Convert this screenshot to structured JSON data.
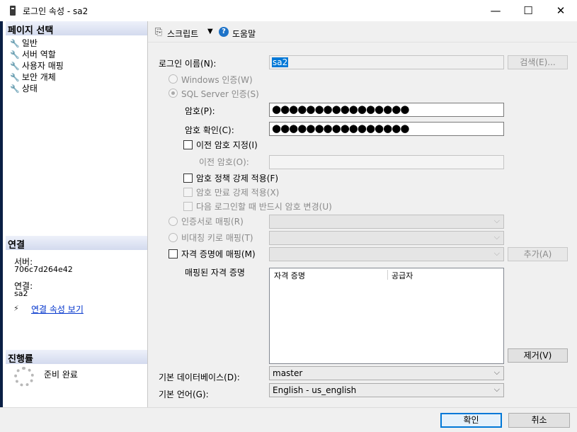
{
  "window": {
    "title": "로그인 속성 - sa2",
    "minimize_glyph": "—",
    "maximize_glyph": "☐",
    "close_glyph": "✕"
  },
  "left_pane": {
    "page_select_header": "페이지 선택",
    "pages": [
      "일반",
      "서버 역할",
      "사용자 매핑",
      "보안 개체",
      "상태"
    ],
    "connection_header": "연결",
    "server_label": "서버:",
    "server_value": "706c7d264e42",
    "connection_label": "연결:",
    "connection_value": "sa2",
    "view_connection_props": "연결 속성 보기",
    "progress_header": "진행률",
    "progress_status": "준비 완료"
  },
  "toolbar": {
    "script_label": "스크립트",
    "help_label": "도움말"
  },
  "form": {
    "login_name_label": "로그인 이름(N):",
    "login_name_value": "sa2",
    "search_button": "검색(E)...",
    "windows_auth": "Windows 인증(W)",
    "sql_auth": "SQL Server 인증(S)",
    "password_label": "암호(P):",
    "password_value": "●●●●●●●●●●●●●●●●",
    "confirm_label": "암호 확인(C):",
    "confirm_value": "●●●●●●●●●●●●●●●●",
    "specify_old_password": "이전 암호 지정(I)",
    "old_password_label": "이전 암호(O):",
    "enforce_policy": "암호 정책 강제 적용(F)",
    "enforce_expiration": "암호 만료 강제 적용(X)",
    "must_change": "다음 로그인할 때 반드시 암호 변경(U)",
    "map_certificate": "인증서로 매핑(R)",
    "map_asymmetric_key": "비대칭 키로 매핑(T)",
    "map_credential": "자격 증명에 매핑(M)",
    "add_button": "추가(A)",
    "mapped_credentials_label": "매핑된 자격 증명",
    "cred_columns": [
      "자격 증명",
      "공급자"
    ],
    "remove_button": "제거(V)",
    "default_db_label": "기본 데이터베이스(D):",
    "default_db_value": "master",
    "default_lang_label": "기본 언어(G):",
    "default_lang_value": "English - us_english"
  },
  "footer": {
    "ok": "확인",
    "cancel": "취소"
  }
}
